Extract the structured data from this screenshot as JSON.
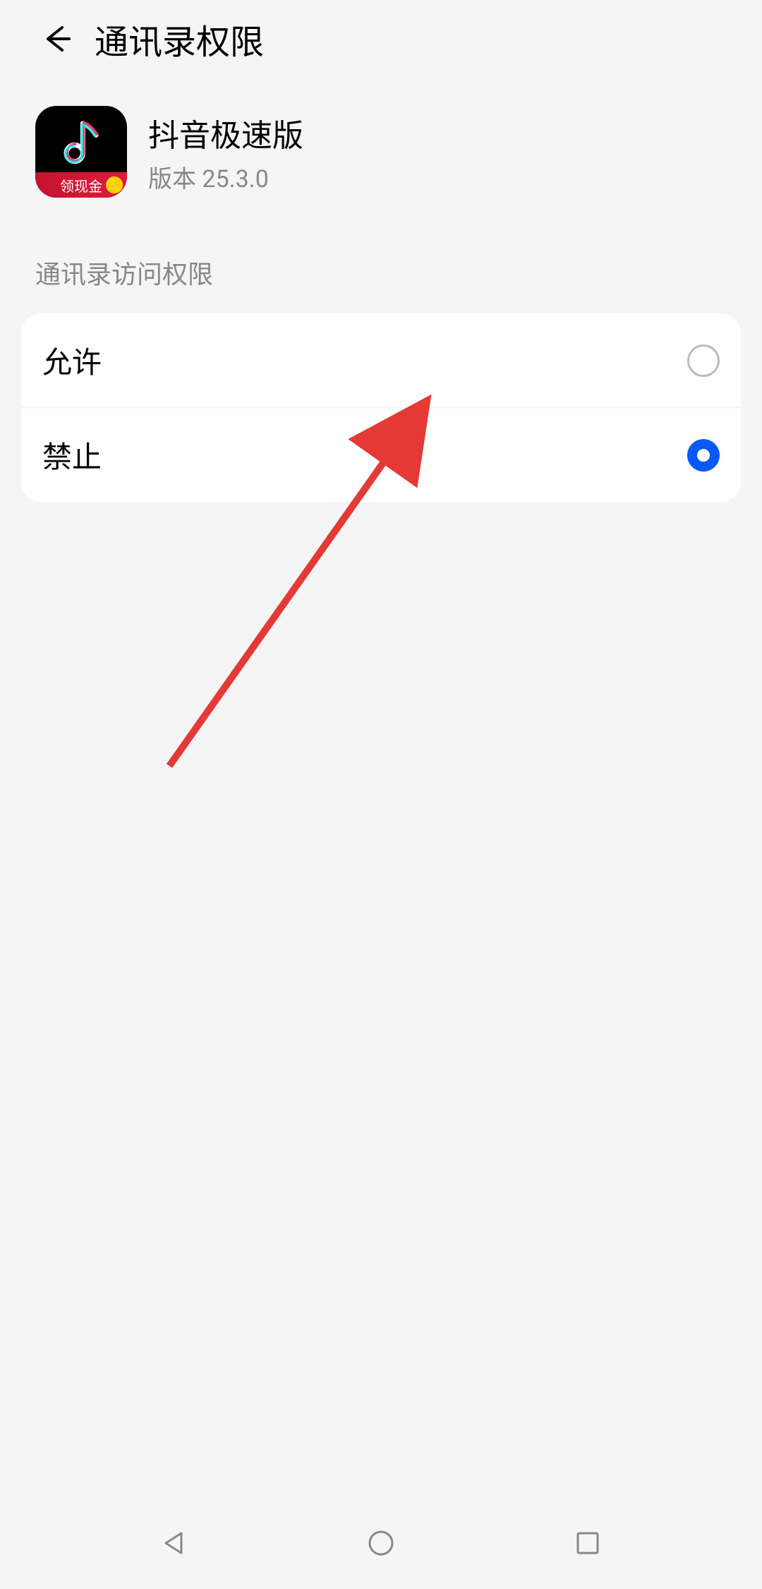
{
  "header": {
    "title": "通讯录权限"
  },
  "app": {
    "name": "抖音极速版",
    "version": "版本 25.3.0",
    "banner_text": "领现金"
  },
  "section": {
    "label": "通讯录访问权限"
  },
  "options": [
    {
      "label": "允许",
      "selected": false
    },
    {
      "label": "禁止",
      "selected": true
    }
  ]
}
